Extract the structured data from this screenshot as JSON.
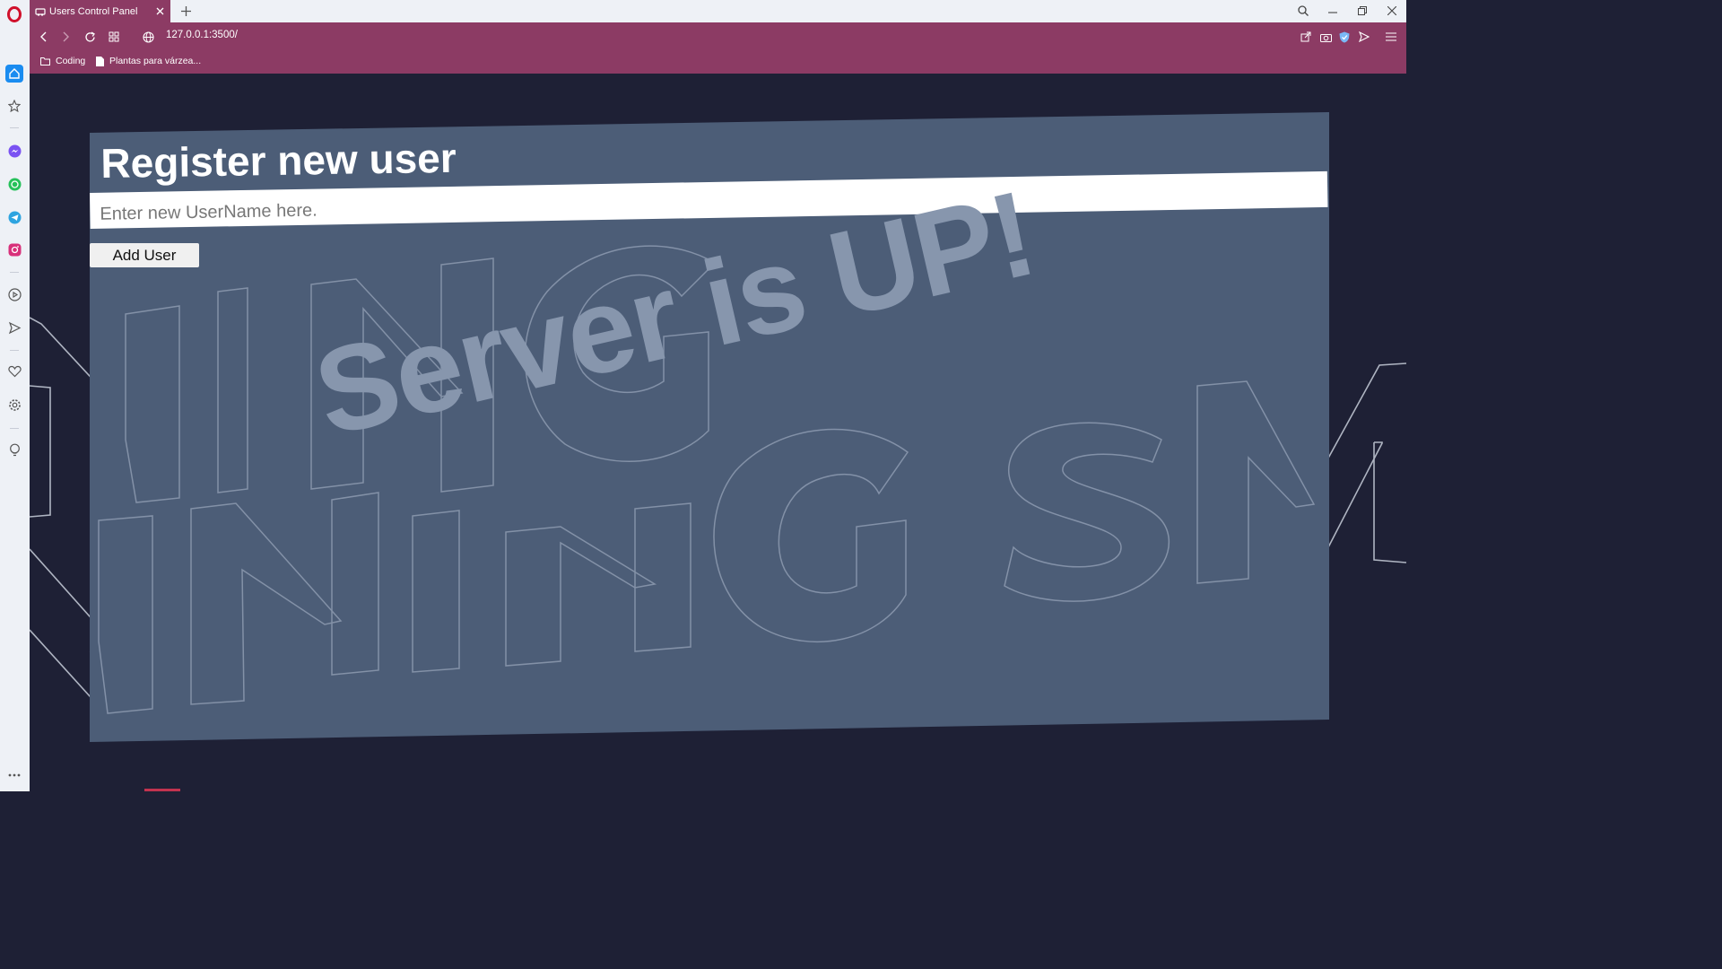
{
  "browser": {
    "tab_title": "Users Control Panel",
    "url": "127.0.0.1:3500/",
    "bookmarks": [
      {
        "label": "Coding",
        "icon": "folder-icon"
      },
      {
        "label": "Plantas para várzea...",
        "icon": "page-icon"
      }
    ],
    "sidebar_icons": [
      "opera-logo-icon",
      "home-icon",
      "star-icon",
      "messenger-icon",
      "whatsapp-icon",
      "telegram-icon",
      "instagram-icon",
      "player-icon",
      "send-icon",
      "heart-icon",
      "gear-icon",
      "bulb-icon",
      "more-icon"
    ],
    "accent_color": "#8c3b64"
  },
  "page": {
    "heading": "Register new user",
    "username_placeholder": "Enter new UserName here.",
    "add_button_label": "Add User",
    "status_banner": "Server is UP!",
    "card_color": "#4c5d77",
    "background_color": "#1e2035",
    "banner_color": "#8796ad"
  }
}
